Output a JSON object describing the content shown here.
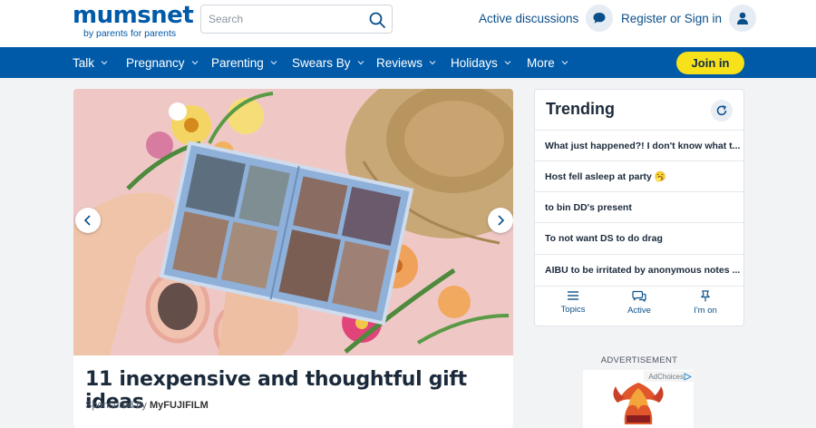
{
  "header": {
    "logo_text": "mumsnet",
    "logo_tagline": "by parents for parents",
    "search_placeholder": "Search",
    "active_discussions": "Active discussions",
    "register_signin": "Register or Sign in"
  },
  "nav": {
    "items": [
      "Talk",
      "Pregnancy",
      "Parenting",
      "Swears By",
      "Reviews",
      "Holidays",
      "More"
    ],
    "join_label": "Join in"
  },
  "feature": {
    "title": "11 inexpensive and thoughtful gift ideas",
    "sponsored_prefix": "Sponsored by",
    "sponsor": "MyFUJIFILM"
  },
  "trending": {
    "title": "Trending",
    "items": [
      "What just happened?! I don't know what t...",
      "Host fell asleep at party 🥱",
      "to bin DD's present",
      "To not want DS to do drag",
      "AIBU to be irritated by anonymous notes ..."
    ],
    "tabs": [
      "Topics",
      "Active",
      "I'm on"
    ]
  },
  "ad": {
    "label": "ADVERTISEMENT",
    "adchoices": "AdChoices"
  },
  "colors": {
    "brand_blue": "#005aa8",
    "join_yellow": "#f6e11b"
  }
}
